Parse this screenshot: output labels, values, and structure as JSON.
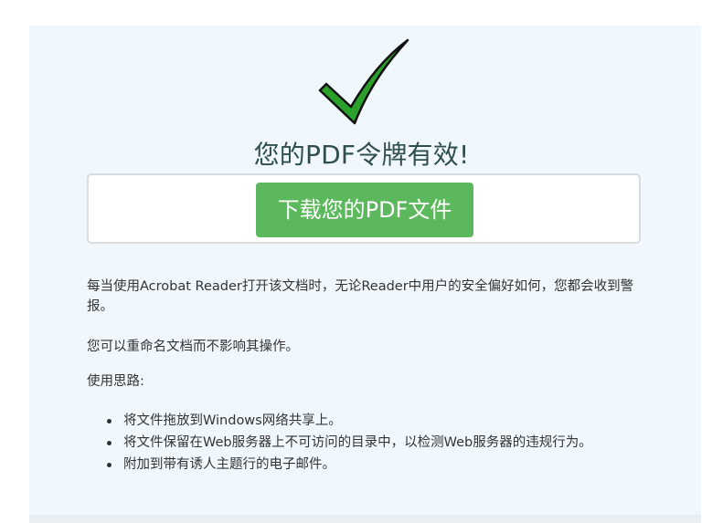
{
  "header": {
    "title": "您的PDF令牌有效!"
  },
  "download": {
    "button_label": "下载您的PDF文件"
  },
  "body": {
    "paragraph1": "每当使用Acrobat Reader打开该文档时，无论Reader中用户的安全偏好如何，您都会收到警报。",
    "paragraph2": "您可以重命名文档而不影响其操作。",
    "tips_heading": "使用思路:"
  },
  "tips": [
    "将文件拖放到Windows网络共享上。",
    "将文件保留在Web服务器上不可访问的目录中，以检测Web服务器的违规行为。",
    "附加到带有诱人主题行的电子邮件。"
  ],
  "colors": {
    "panel_bg": "#f0f7fd",
    "button_bg": "#5cb85c",
    "check_green": "#2aa12a",
    "title_text": "#2f4f4f"
  },
  "icons": {
    "success": "checkmark-icon"
  }
}
